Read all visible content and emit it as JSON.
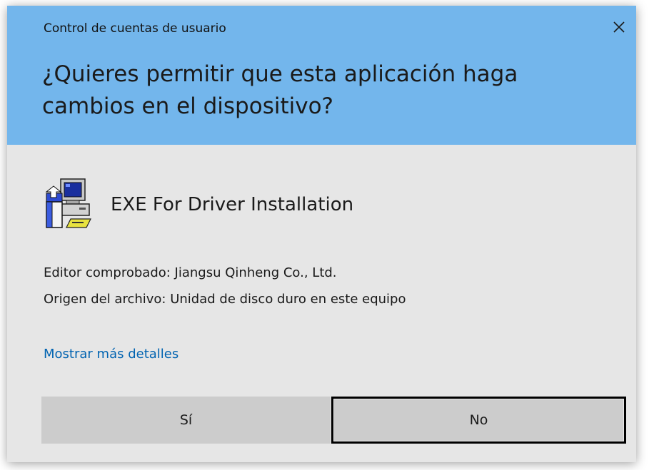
{
  "dialog": {
    "caption": "Control de cuentas de usuario",
    "question": "¿Quieres permitir que esta aplicación haga cambios en el dispositivo?",
    "app": {
      "name": "EXE For Driver Installation",
      "icon": "computer-installer-icon"
    },
    "publisher_line": "Editor comprobado: Jiangsu Qinheng Co., Ltd.",
    "origin_line": "Origen del archivo: Unidad de disco duro en este equipo",
    "details_link": "Mostrar más detalles",
    "buttons": {
      "yes_label": "Sí",
      "no_label": "No"
    },
    "colors": {
      "header": "#73b6ec",
      "body": "#e6e6e6",
      "link": "#0063b1",
      "button": "#cccccc"
    }
  }
}
